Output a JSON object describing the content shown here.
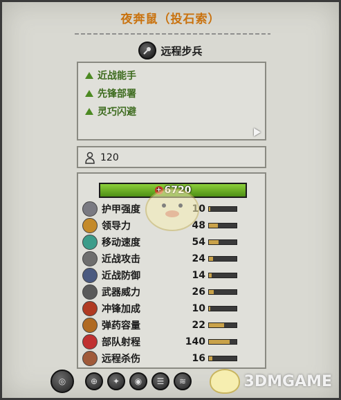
{
  "header": {
    "title": "夜奔鼠（投石索）",
    "unit_type": "远程步兵"
  },
  "abilities": [
    {
      "label": "近战能手"
    },
    {
      "label": "先锋部署"
    },
    {
      "label": "灵巧闪避"
    }
  ],
  "cost": {
    "value": "120"
  },
  "health": {
    "value": "6720",
    "fraction": 1.0
  },
  "stats": [
    {
      "label": "护甲强度",
      "value": "10",
      "fraction": 0.06,
      "icon": "armor-icon",
      "color": "#7a7a82"
    },
    {
      "label": "领导力",
      "value": "48",
      "fraction": 0.32,
      "icon": "leadership-icon",
      "color": "#c48a2a"
    },
    {
      "label": "移动速度",
      "value": "54",
      "fraction": 0.36,
      "icon": "speed-icon",
      "color": "#3c9c8a"
    },
    {
      "label": "近战攻击",
      "value": "24",
      "fraction": 0.16,
      "icon": "melee-attack-icon",
      "color": "#6e6e6e"
    },
    {
      "label": "近战防御",
      "value": "14",
      "fraction": 0.1,
      "icon": "melee-defence-icon",
      "color": "#4a5a80"
    },
    {
      "label": "武器威力",
      "value": "26",
      "fraction": 0.17,
      "icon": "weapon-strength-icon",
      "color": "#5a5a5a"
    },
    {
      "label": "冲锋加成",
      "value": "10",
      "fraction": 0.06,
      "icon": "charge-bonus-icon",
      "color": "#b03a22"
    },
    {
      "label": "弹药容量",
      "value": "22",
      "fraction": 0.55,
      "icon": "ammunition-icon",
      "color": "#b06a22"
    },
    {
      "label": "部队射程",
      "value": "140",
      "fraction": 0.75,
      "icon": "range-icon",
      "color": "#c03030"
    },
    {
      "label": "远程杀伤",
      "value": "16",
      "fraction": 0.12,
      "icon": "missile-damage-icon",
      "color": "#a05a3a"
    }
  ],
  "watermark": {
    "text": "3DMGAME"
  },
  "colors": {
    "title": "#c9720e",
    "ability": "#3d6b1e",
    "health_fill": "#6fb02a",
    "stat_fill": "#c9a24a"
  }
}
